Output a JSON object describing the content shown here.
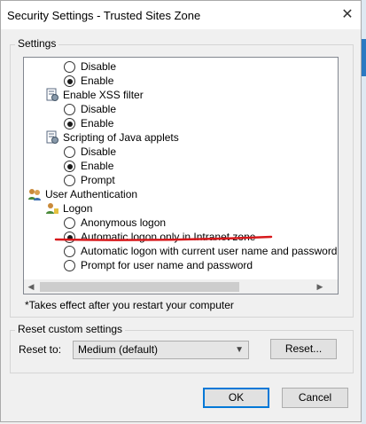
{
  "window": {
    "title": "Security Settings - Trusted Sites Zone",
    "close_glyph": "✕"
  },
  "settings_group": {
    "label": "Settings"
  },
  "list_items": [
    {
      "kind": "radio",
      "checked": false,
      "label": "Disable"
    },
    {
      "kind": "radio",
      "checked": true,
      "label": "Enable"
    },
    {
      "kind": "category",
      "icon": "script-settings-icon",
      "label": "Enable XSS filter"
    },
    {
      "kind": "radio",
      "checked": false,
      "label": "Disable"
    },
    {
      "kind": "radio",
      "checked": true,
      "label": "Enable"
    },
    {
      "kind": "category",
      "icon": "script-settings-icon",
      "label": "Scripting of Java applets"
    },
    {
      "kind": "radio",
      "checked": false,
      "label": "Disable"
    },
    {
      "kind": "radio",
      "checked": true,
      "label": "Enable"
    },
    {
      "kind": "radio",
      "checked": false,
      "label": "Prompt"
    },
    {
      "kind": "category",
      "icon": "users-icon",
      "label": "User Authentication"
    },
    {
      "kind": "category",
      "icon": "user-logon-icon",
      "label": "Logon"
    },
    {
      "kind": "radio",
      "checked": false,
      "label": "Anonymous logon"
    },
    {
      "kind": "radio",
      "checked": true,
      "label": "Automatic logon only in Intranet zone"
    },
    {
      "kind": "radio",
      "checked": false,
      "label": "Automatic logon with current user name and password"
    },
    {
      "kind": "radio",
      "checked": false,
      "label": "Prompt for user name and password"
    }
  ],
  "annotation": {
    "color": "#d7191c"
  },
  "note": "*Takes effect after you restart your computer",
  "reset_group": {
    "label": "Reset custom settings",
    "reset_to_label": "Reset to:",
    "selected_level": "Medium (default)",
    "reset_button": "Reset..."
  },
  "footer": {
    "ok": "OK",
    "cancel": "Cancel"
  },
  "colors": {
    "accent": "#0078d7",
    "annotation_line": "#d7191c"
  }
}
